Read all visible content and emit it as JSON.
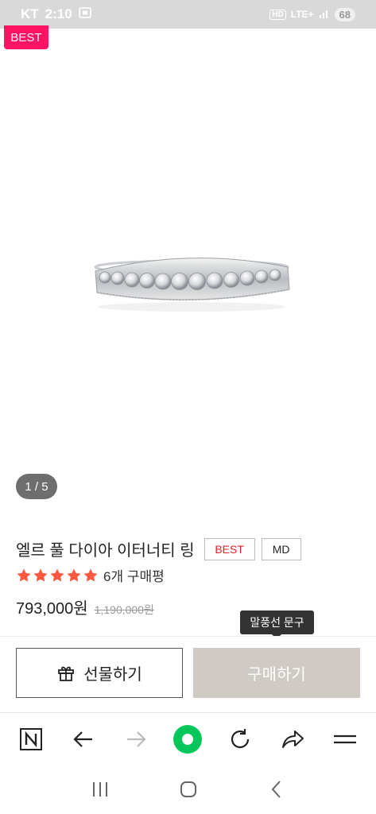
{
  "status_bar": {
    "carrier": "KT",
    "time": "2:10",
    "network": "LTE+",
    "hd": "HD",
    "battery": "68"
  },
  "product": {
    "best_tag": "BEST",
    "image_pager": "1 / 5",
    "title": "엘르 풀 다이아 이터너티 링",
    "badges": [
      "BEST",
      "MD"
    ],
    "rating": 5,
    "review_count": "6개 구매평",
    "price": "793,000원",
    "original_price": "1,190,000원"
  },
  "tooltip": "말풍선 문구",
  "actions": {
    "gift_label": "선물하기",
    "buy_label": "구매하기"
  },
  "browser_toolbar": {
    "icons": [
      "naver-n-icon",
      "back-arrow-icon",
      "forward-arrow-icon",
      "green-dot-icon",
      "refresh-icon",
      "share-icon",
      "menu-icon"
    ]
  },
  "system_nav": {
    "icons": [
      "recent-apps-icon",
      "home-icon",
      "back-icon"
    ]
  },
  "colors": {
    "best_tag": "#ff1464",
    "badge_best_text": "#e3212c",
    "star": "#ff5740",
    "buy_button": "#cfcac3",
    "green_button": "#03c75a"
  }
}
